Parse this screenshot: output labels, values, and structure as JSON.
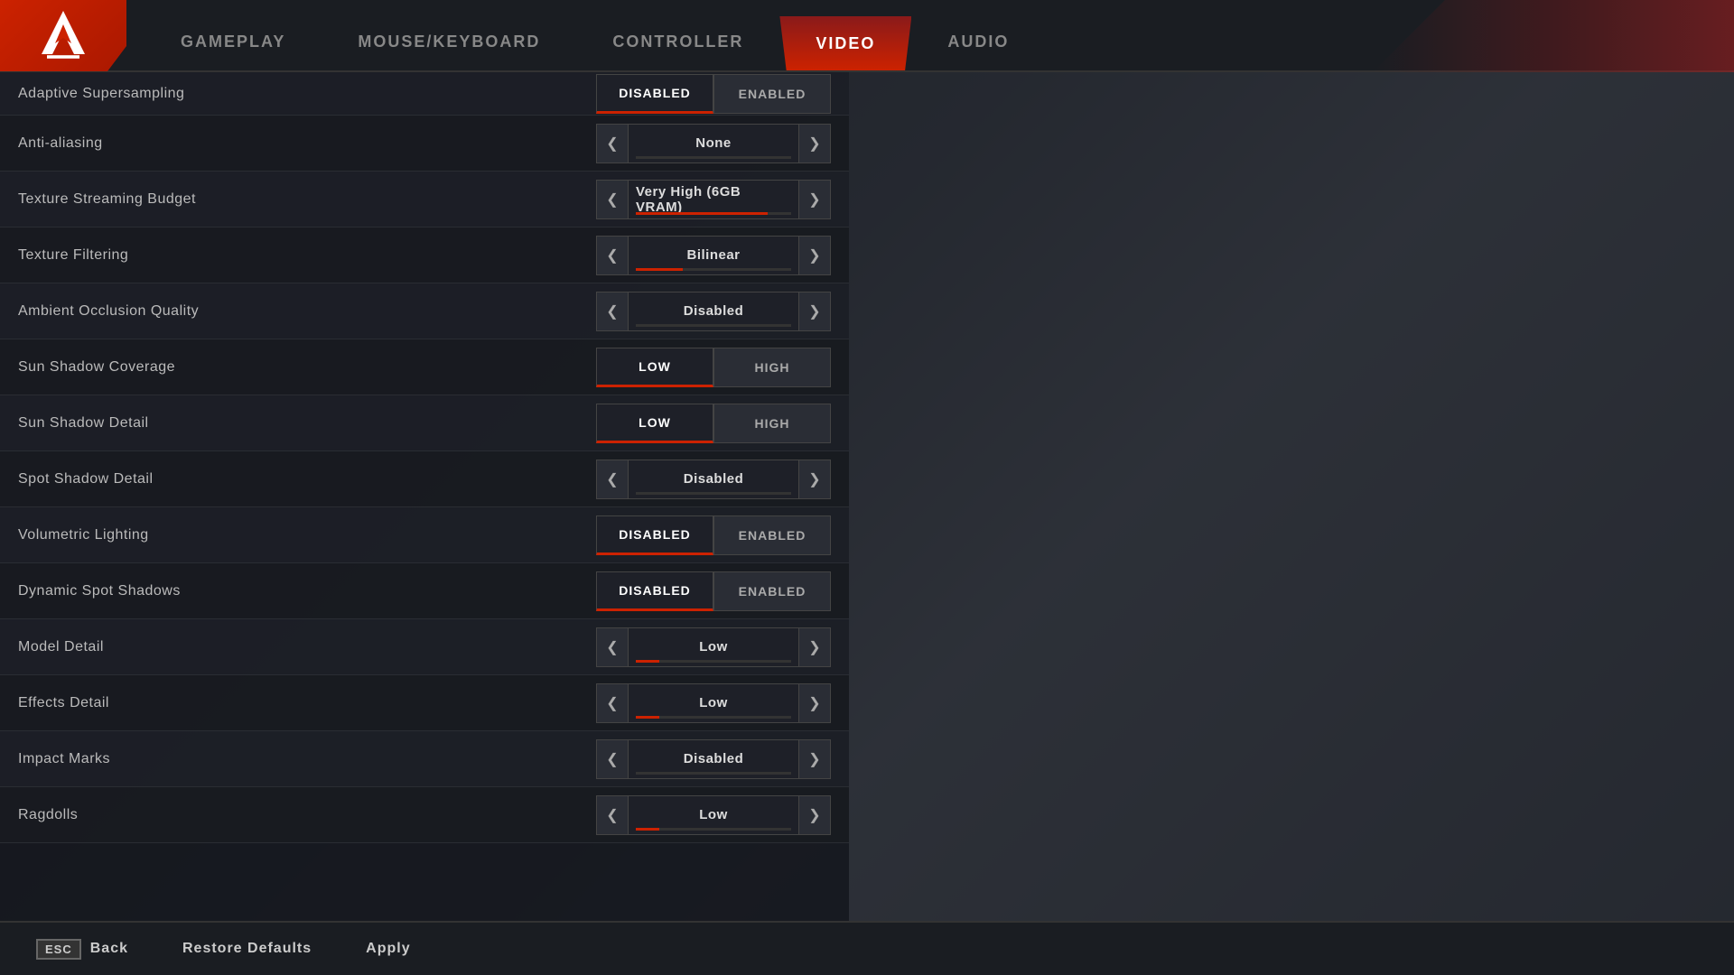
{
  "header": {
    "tabs": [
      {
        "id": "gameplay",
        "label": "GAMEPLAY",
        "active": false
      },
      {
        "id": "mouse-keyboard",
        "label": "MOUSE/KEYBOARD",
        "active": false
      },
      {
        "id": "controller",
        "label": "CONTROLLER",
        "active": false
      },
      {
        "id": "video",
        "label": "VIDEO",
        "active": true
      },
      {
        "id": "audio",
        "label": "AUDIO",
        "active": false
      }
    ]
  },
  "settings": {
    "rows": [
      {
        "id": "adaptive-supersampling",
        "label": "Adaptive Supersampling",
        "type": "toggle",
        "options": [
          "Disabled",
          "Enabled"
        ],
        "selected": 0,
        "partial": true
      },
      {
        "id": "anti-aliasing",
        "label": "Anti-aliasing",
        "type": "arrow",
        "value": "None",
        "bar_fill": 0
      },
      {
        "id": "texture-streaming-budget",
        "label": "Texture Streaming Budget",
        "type": "arrow",
        "value": "Very High (6GB VRAM)",
        "bar_fill": 85
      },
      {
        "id": "texture-filtering",
        "label": "Texture Filtering",
        "type": "arrow",
        "value": "Bilinear",
        "bar_fill": 30
      },
      {
        "id": "ambient-occlusion",
        "label": "Ambient Occlusion Quality",
        "type": "arrow",
        "value": "Disabled",
        "bar_fill": 0
      },
      {
        "id": "sun-shadow-coverage",
        "label": "Sun Shadow Coverage",
        "type": "toggle",
        "options": [
          "Low",
          "High"
        ],
        "selected": 0
      },
      {
        "id": "sun-shadow-detail",
        "label": "Sun Shadow Detail",
        "type": "toggle",
        "options": [
          "Low",
          "High"
        ],
        "selected": 0
      },
      {
        "id": "spot-shadow-detail",
        "label": "Spot Shadow Detail",
        "type": "arrow",
        "value": "Disabled",
        "bar_fill": 0
      },
      {
        "id": "volumetric-lighting",
        "label": "Volumetric Lighting",
        "type": "toggle",
        "options": [
          "Disabled",
          "Enabled"
        ],
        "selected": 0
      },
      {
        "id": "dynamic-spot-shadows",
        "label": "Dynamic Spot Shadows",
        "type": "toggle",
        "options": [
          "Disabled",
          "Enabled"
        ],
        "selected": 0
      },
      {
        "id": "model-detail",
        "label": "Model Detail",
        "type": "arrow",
        "value": "Low",
        "bar_fill": 15
      },
      {
        "id": "effects-detail",
        "label": "Effects Detail",
        "type": "arrow",
        "value": "Low",
        "bar_fill": 15
      },
      {
        "id": "impact-marks",
        "label": "Impact Marks",
        "type": "arrow",
        "value": "Disabled",
        "bar_fill": 0
      },
      {
        "id": "ragdolls",
        "label": "Ragdolls",
        "type": "arrow",
        "value": "Low",
        "bar_fill": 15
      }
    ]
  },
  "footer": {
    "back_key": "ESC",
    "back_label": "Back",
    "restore_label": "Restore Defaults",
    "apply_label": "Apply"
  }
}
